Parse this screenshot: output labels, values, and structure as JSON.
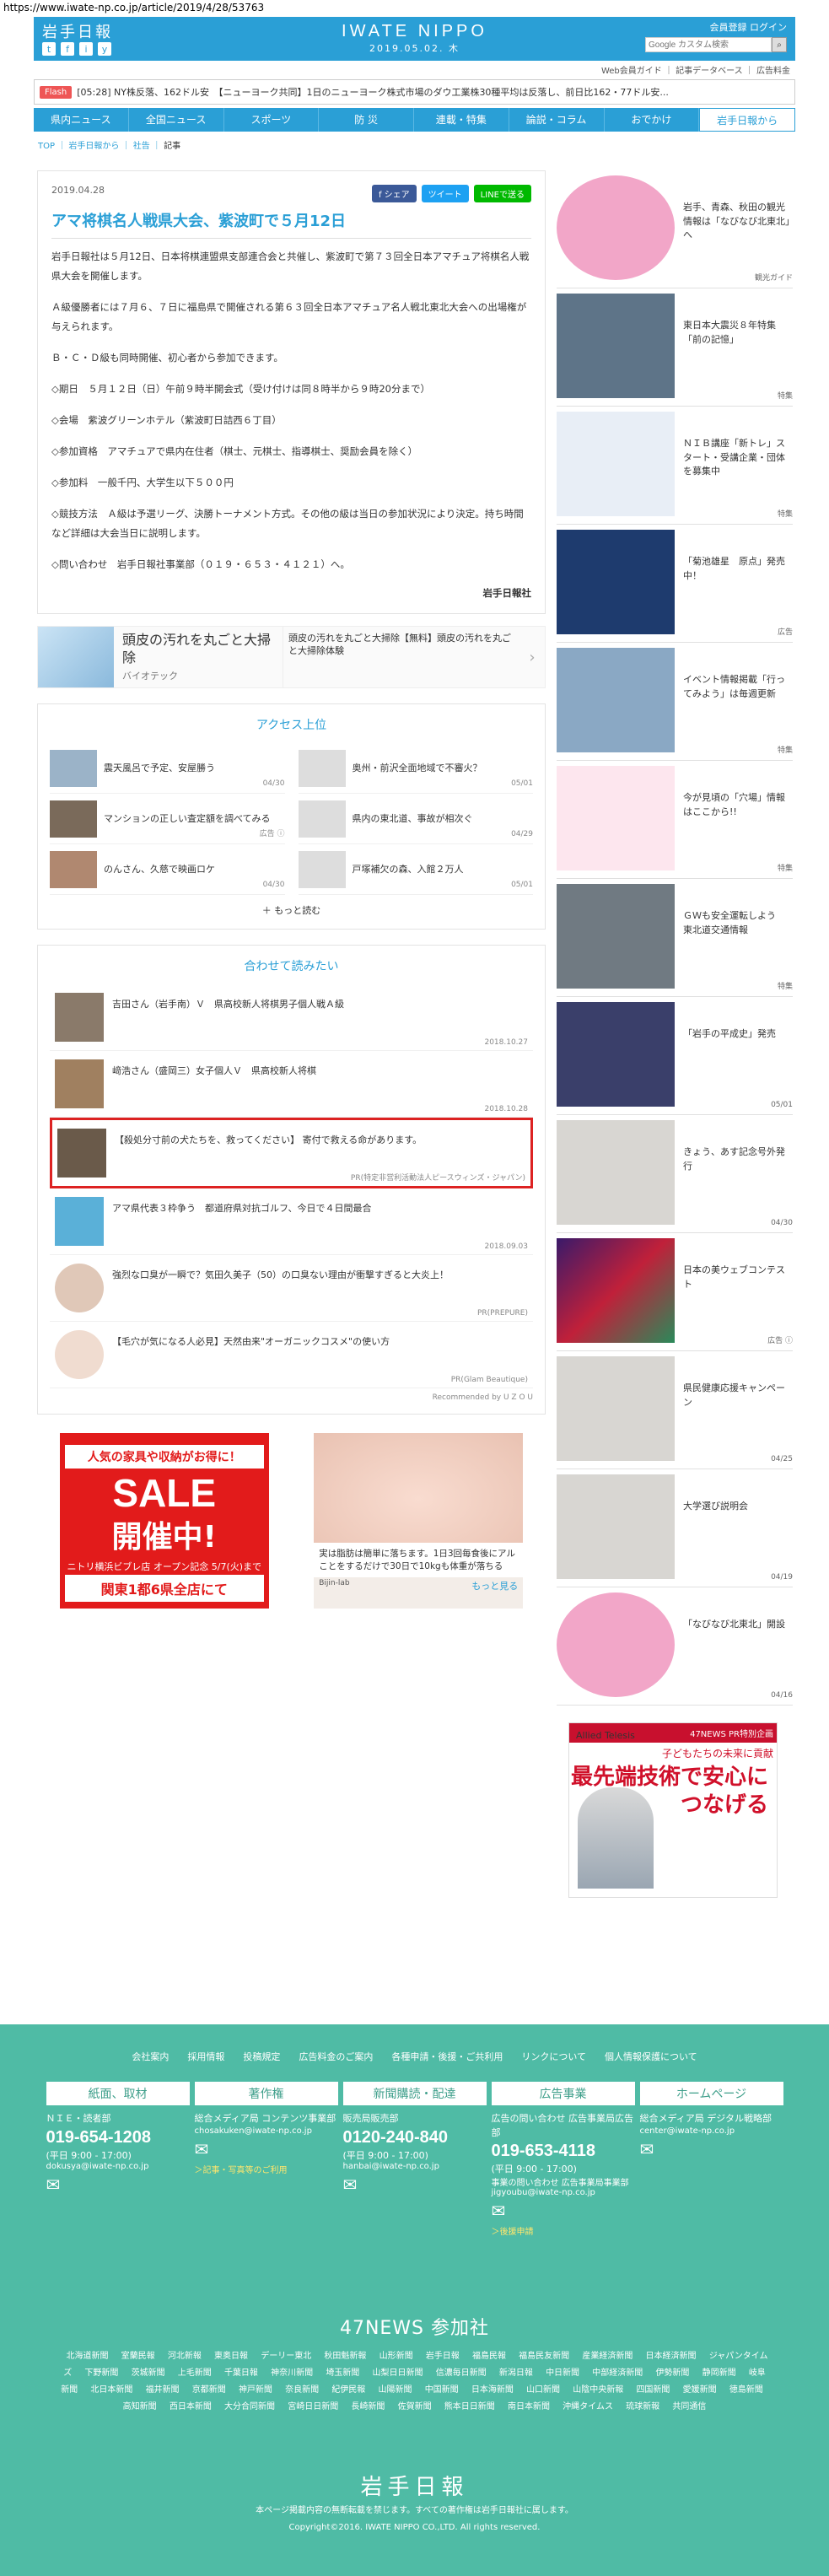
{
  "url": "https://www.iwate-np.co.jp/article/2019/4/28/53763",
  "header": {
    "logo": "岩手日報",
    "brand": "IWATE NIPPO",
    "date": "2019.05.02. 木",
    "member_links": "会員登録 ログイン",
    "search_placeholder": "Google カスタム検索",
    "social": [
      "t",
      "f",
      "i",
      "y"
    ]
  },
  "subbar": "Web会員ガイド ｜ 記事データベース ｜ 広告料金",
  "flash": {
    "tag": "Flash",
    "text": "[05:28] NY株反落、162ドル安　【ニューヨーク共同】1日のニューヨーク株式市場のダウ工業株30種平均は反落し、前日比162・77ドル安..."
  },
  "gnav": [
    "県内ニュース",
    "全国ニュース",
    "スポーツ",
    "防 災",
    "連載・特集",
    "論説・コラム",
    "おでかけ",
    "岩手日報から"
  ],
  "breadcrumb": {
    "items": [
      "TOP",
      "岩手日報から",
      "社告"
    ],
    "current": "記事"
  },
  "article": {
    "date": "2019.04.28",
    "share": [
      "f シェア",
      "ツイート",
      "LINEで送る"
    ],
    "title": "アマ将棋名人戦県大会、紫波町で５月12日",
    "paragraphs": [
      "岩手日報社は５月12日、日本将棋連盟県支部連合会と共催し、紫波町で第７３回全日本アマチュア将棋名人戦県大会を開催します。",
      "Ａ級優勝者には７月６、７日に福島県で開催される第６３回全日本アマチュア名人戦北東北大会への出場権が与えられます。",
      "Ｂ・Ｃ・Ｄ級も同時開催、初心者から参加できます。",
      "◇期日　５月１２日（日）午前９時半開会式（受け付けは同８時半から９時20分まで）",
      "◇会場　紫波グリーンホテル（紫波町日詰西６丁目）",
      "◇参加資格　アマチュアで県内在住者（棋士、元棋士、指導棋士、奨励会員を除く）",
      "◇参加料　一般千円、大学生以下５００円",
      "◇競技方法　Ａ級は予選リーグ、決勝トーナメント方式。その他の級は当日の参加状況により決定。持ち時間など詳細は大会当日に説明します。",
      "◇問い合わせ　岩手日報社事業部（０１９・６５３・４１２１）へ。"
    ],
    "sign": "岩手日報社"
  },
  "ad_wide": {
    "title": "頭皮の汚れを丸ごと大掃除",
    "sponsor": "バイオテック",
    "desc": "頭皮の汚れを丸ごと大掃除【無料】頭皮の汚れを丸ごと大掃除体験"
  },
  "ranking": {
    "title": "アクセス上位",
    "items": [
      {
        "title": "震天風呂で予定、安屋勝う",
        "date": "04/30"
      },
      {
        "title": "奥州・前沢全面地域で不審火？",
        "date": "05/01"
      },
      {
        "title": "マンションの正しい査定額を調べてみる",
        "date": "広告 ⓘ"
      },
      {
        "title": "県内の東北道、事故が相次ぐ",
        "date": "04/29"
      },
      {
        "title": "のんさん、久慈で映画ロケ",
        "date": "04/30"
      },
      {
        "title": "戸塚補欠の森、入館２万人",
        "date": "05/01"
      }
    ],
    "more": "＋ もっと読む"
  },
  "recommend": {
    "title": "合わせて読みたい",
    "items": [
      {
        "title": "吉田さん（岩手南）Ｖ　県高校新人将棋男子個人戦Ａ級",
        "date": "2018.10.27"
      },
      {
        "title": "﨑浩さん（盛岡三）女子個人Ｖ　県高校新人将棋",
        "date": "2018.10.28"
      },
      {
        "title": "【殺処分寸前の犬たちを、救ってください】 寄付で救える命があります。",
        "date": "PR(特定非営利活動法人ピースウィンズ・ジャパン)"
      },
      {
        "title": "アマ県代表３枠争う　都道府県対抗ゴルフ、今日で４日間最合",
        "date": "2018.09.03"
      },
      {
        "title": "強烈な口臭が一瞬で？気田久美子（50）の口臭ない理由が衝撃すぎると大炎上！",
        "date": "PR(PREPURE)"
      },
      {
        "title": "【毛穴が気になる人必見】天然由来\"オーガニックコスメ\"の使い方",
        "date": "PR(Glam Beautique)"
      }
    ],
    "powered": "Recommended by U Z O U"
  },
  "ad_nitori": {
    "top": "人気の家具や収納がお得に！",
    "sale": "SALE",
    "open": "開催中!",
    "sub": "ニトリ横浜ビブレ店 オープン記念 5/7(火)まで",
    "bot": "関東1都6県全店にて"
  },
  "ad_bijin": {
    "text": "実は脂肪は簡単に落ちます。1日3回毎食後にアルことをするだけで30日で10kgも体重が落ちる",
    "brand": "Bijin-lab",
    "more": "もっと見る"
  },
  "sidebar": [
    {
      "title": "岩手、青森、秋田の観光情報は「なびなび北東北」へ",
      "label": "観光ガイド"
    },
    {
      "title": "東日本大震災８年特集「前の記憶」",
      "label": "特集"
    },
    {
      "title": "ＮＩＢ講座「新トレ」スタート・受講企業・団体を募集中",
      "label": "特集"
    },
    {
      "title": "「菊池雄星　原点」発売中！",
      "label": "広告"
    },
    {
      "title": "イベント情報掲載「行ってみよう」は毎週更新",
      "label": "特集"
    },
    {
      "title": "今が見頃の「穴場」情報はここから!!",
      "label": "特集"
    },
    {
      "title": "ＧＷも安全運転しよう　東北道交通情報",
      "label": "特集"
    },
    {
      "title": "「岩手の平成史」発売",
      "label": "05/01"
    },
    {
      "title": "きょう、あす記念号外発行",
      "label": "04/30"
    },
    {
      "title": "日本の美ウェブコンテスト",
      "label": "広告 ⓘ"
    },
    {
      "title": "県民健康応援キャンペーン",
      "label": "04/25"
    },
    {
      "title": "大学選び説明会",
      "label": "04/19"
    },
    {
      "title": "「なびなび北東北」開設",
      "label": "04/16"
    }
  ],
  "side_ad": {
    "tag": "47NEWS PR特別企画",
    "sub": "子どもたちの未来に貢献",
    "big": "最先端技術で安心につなげる",
    "brand": "Allied Telesis"
  },
  "footer": {
    "links": [
      "会社案内",
      "採用情報",
      "投稿規定",
      "広告料金のご案内",
      "各種申請・後援・ご共利用",
      "リンクについて",
      "個人情報保護について"
    ],
    "cols": [
      {
        "head": "紙面、取材",
        "lab": "ＮＩＥ・読者部",
        "tel": "019-654-1208",
        "hrs": "(平日 9:00 - 17:00)",
        "mail": "dokusya@iwate-np.co.jp",
        "lnk": ""
      },
      {
        "head": "著作権",
        "lab": "総合メディア局 コンテンツ事業部",
        "tel": "",
        "hrs": "",
        "mail": "chosakuken@iwate-np.co.jp",
        "lnk": "＞記事・写真等のご利用"
      },
      {
        "head": "新聞購読・配達",
        "lab": "販売局販売部",
        "tel": "0120-240-840",
        "hrs": "(平日 9:00 - 17:00)",
        "mail": "hanbai@iwate-np.co.jp",
        "lnk": ""
      },
      {
        "head": "広告事業",
        "lab": "広告の問い合わせ 広告事業局広告部",
        "tel": "019-653-4118",
        "hrs": "(平日 9:00 - 17:00)",
        "mail": "事業の問い合わせ 広告事業局事業部 jigyoubu@iwate-np.co.jp",
        "lnk": "＞後援申請"
      },
      {
        "head": "ホームページ",
        "lab": "総合メディア局 デジタル戦略部",
        "tel": "",
        "hrs": "",
        "mail": "center@iwate-np.co.jp",
        "lnk": ""
      }
    ],
    "n47": "47NEWS 参加社",
    "papers": [
      "北海道新聞",
      "室蘭民報",
      "河北新報",
      "東奥日報",
      "デーリー東北",
      "秋田魁新報",
      "山形新聞",
      "岩手日報",
      "福島民報",
      "福島民友新聞",
      "産業経済新聞",
      "日本経済新聞",
      "ジャパンタイムズ",
      "下野新聞",
      "茨城新聞",
      "上毛新聞",
      "千葉日報",
      "神奈川新聞",
      "埼玉新聞",
      "山梨日日新聞",
      "信濃毎日新聞",
      "新潟日報",
      "中日新聞",
      "中部経済新聞",
      "伊勢新聞",
      "静岡新聞",
      "岐阜新聞",
      "北日本新聞",
      "福井新聞",
      "京都新聞",
      "神戸新聞",
      "奈良新聞",
      "紀伊民報",
      "山陽新聞",
      "中国新聞",
      "日本海新聞",
      "山口新聞",
      "山陰中央新報",
      "四国新聞",
      "愛媛新聞",
      "徳島新聞",
      "高知新聞",
      "西日本新聞",
      "大分合同新聞",
      "宮崎日日新聞",
      "長崎新聞",
      "佐賀新聞",
      "熊本日日新聞",
      "南日本新聞",
      "沖縄タイムス",
      "琉球新報",
      "共同通信"
    ],
    "logo": "岩手日報",
    "notice": "本ページ掲載内容の無断転載を禁じます。すべての著作権は岩手日報社に属します。",
    "copyright": "Copyright©2016. IWATE NIPPO CO.,LTD. All rights reserved."
  }
}
